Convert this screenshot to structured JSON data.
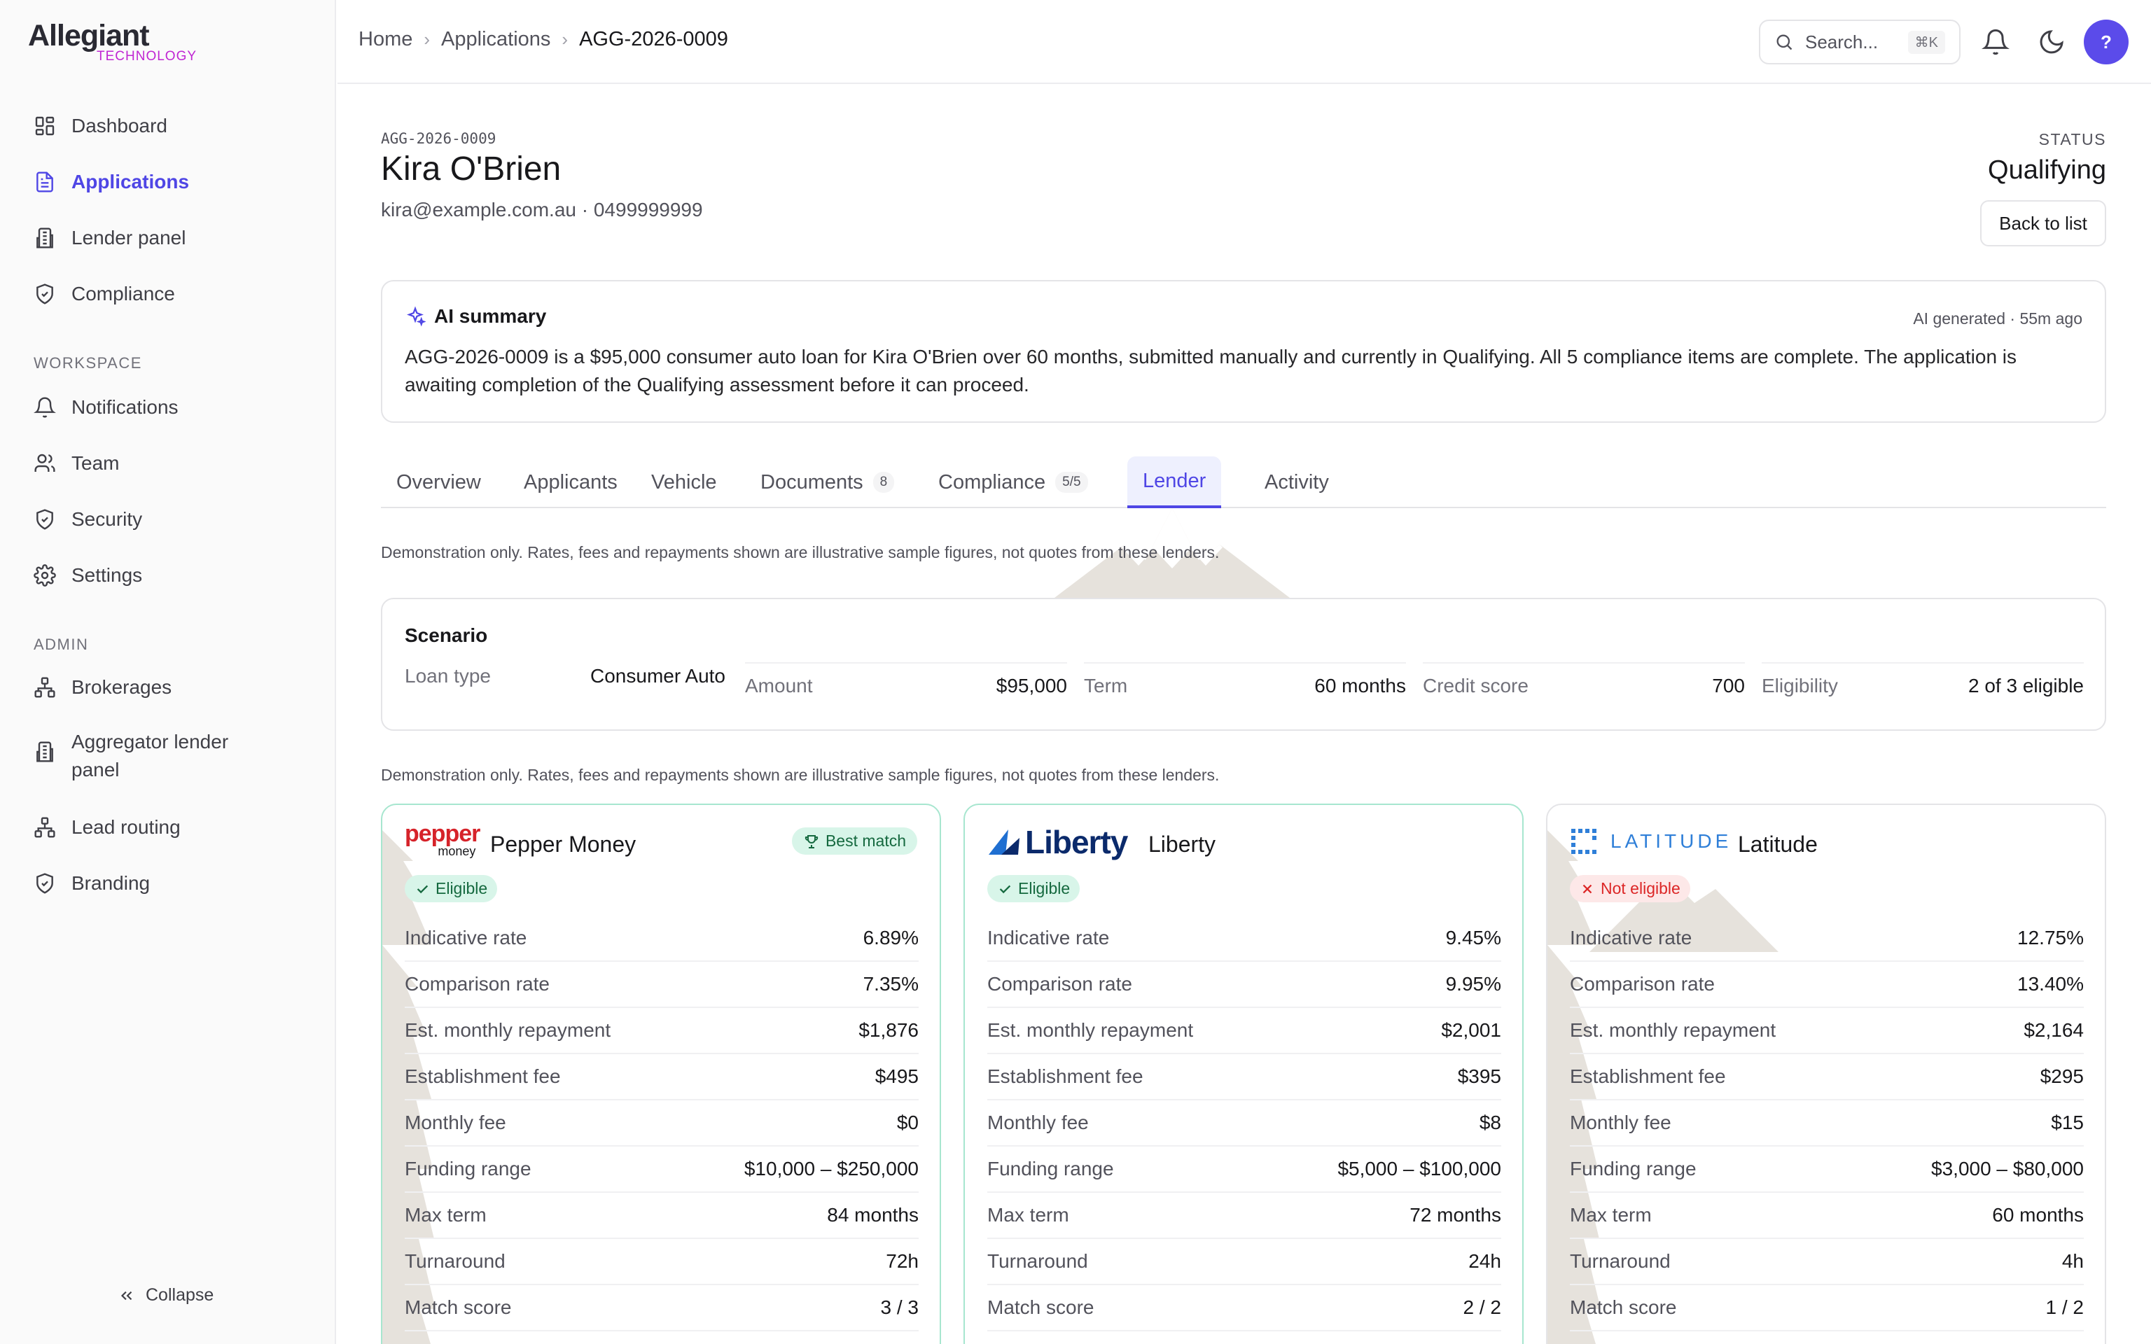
{
  "brand": {
    "name": "Allegiant",
    "sub": "TECHNOLOGY"
  },
  "sidebar": {
    "items": [
      {
        "label": "Dashboard",
        "icon": "dashboard-icon"
      },
      {
        "label": "Applications",
        "icon": "file-text-icon",
        "active": true
      },
      {
        "label": "Lender panel",
        "icon": "building-icon"
      },
      {
        "label": "Compliance",
        "icon": "shield-check-icon"
      }
    ],
    "workspace_heading": "WORKSPACE",
    "workspace": [
      {
        "label": "Notifications",
        "icon": "bell-icon"
      },
      {
        "label": "Team",
        "icon": "users-icon"
      },
      {
        "label": "Security",
        "icon": "shield-check-icon"
      },
      {
        "label": "Settings",
        "icon": "gear-icon"
      }
    ],
    "admin_heading": "ADMIN",
    "admin": [
      {
        "label": "Brokerages",
        "icon": "network-icon"
      },
      {
        "label": "Aggregator lender panel",
        "icon": "building-icon"
      },
      {
        "label": "Lead routing",
        "icon": "network-icon"
      },
      {
        "label": "Branding",
        "icon": "shield-icon"
      }
    ],
    "collapse_label": "Collapse"
  },
  "topbar": {
    "breadcrumb": [
      "Home",
      "Applications",
      "AGG-2026-0009"
    ],
    "search_placeholder": "Search...",
    "search_shortcut": "⌘K",
    "avatar_label": "?"
  },
  "application": {
    "id": "AGG-2026-0009",
    "name": "Kira O'Brien",
    "contact": "kira@example.com.au · 0499999999",
    "status_label": "STATUS",
    "status": "Qualifying",
    "back_label": "Back to list"
  },
  "ai_summary": {
    "title": "AI summary",
    "meta": "AI generated · 55m ago",
    "body": "AGG-2026-0009 is a $95,000 consumer auto loan for Kira O'Brien over 60 months, submitted manually and currently in Qualifying. All 5 compliance items are complete. The application is awaiting completion of the Qualifying assessment before it can proceed."
  },
  "tabs": [
    {
      "label": "Overview",
      "count": ""
    },
    {
      "label": "Applicants",
      "count": ""
    },
    {
      "label": "Vehicle",
      "count": ""
    },
    {
      "label": "Documents",
      "count": "8"
    },
    {
      "label": "Compliance",
      "count": "5/5"
    },
    {
      "label": "Lender",
      "count": "",
      "active": true
    },
    {
      "label": "Activity",
      "count": ""
    }
  ],
  "disclaimer": "Demonstration only. Rates, fees and repayments shown are illustrative sample figures, not quotes from these lenders.",
  "scenario": {
    "title": "Scenario",
    "fields": [
      {
        "label": "Loan type",
        "value": "Consumer Auto"
      },
      {
        "label": "Amount",
        "value": "$95,000"
      },
      {
        "label": "Term",
        "value": "60 months"
      },
      {
        "label": "Credit score",
        "value": "700"
      },
      {
        "label": "Eligibility",
        "value": "2 of 3 eligible"
      }
    ]
  },
  "lenders": [
    {
      "name": "Pepper Money",
      "logo_word": "pepper",
      "logo_sub": "money",
      "badge": "Best match",
      "eligibility": "Eligible",
      "eligible": true,
      "rows": [
        {
          "k": "Indicative rate",
          "v": "6.89%"
        },
        {
          "k": "Comparison rate",
          "v": "7.35%"
        },
        {
          "k": "Est. monthly repayment",
          "v": "$1,876"
        },
        {
          "k": "Establishment fee",
          "v": "$495"
        },
        {
          "k": "Monthly fee",
          "v": "$0"
        },
        {
          "k": "Funding range",
          "v": "$10,000 – $250,000"
        },
        {
          "k": "Max term",
          "v": "84 months"
        },
        {
          "k": "Turnaround",
          "v": "72h"
        },
        {
          "k": "Match score",
          "v": "3 / 3"
        }
      ]
    },
    {
      "name": "Liberty",
      "logo_word": "Liberty",
      "eligibility": "Eligible",
      "eligible": true,
      "rows": [
        {
          "k": "Indicative rate",
          "v": "9.45%"
        },
        {
          "k": "Comparison rate",
          "v": "9.95%"
        },
        {
          "k": "Est. monthly repayment",
          "v": "$2,001"
        },
        {
          "k": "Establishment fee",
          "v": "$395"
        },
        {
          "k": "Monthly fee",
          "v": "$8"
        },
        {
          "k": "Funding range",
          "v": "$5,000 – $100,000"
        },
        {
          "k": "Max term",
          "v": "72 months"
        },
        {
          "k": "Turnaround",
          "v": "24h"
        },
        {
          "k": "Match score",
          "v": "2 / 2"
        }
      ]
    },
    {
      "name": "Latitude",
      "logo_word": "LATITUDE",
      "eligibility": "Not eligible",
      "eligible": false,
      "rows": [
        {
          "k": "Indicative rate",
          "v": "12.75%"
        },
        {
          "k": "Comparison rate",
          "v": "13.40%"
        },
        {
          "k": "Est. monthly repayment",
          "v": "$2,164"
        },
        {
          "k": "Establishment fee",
          "v": "$295"
        },
        {
          "k": "Monthly fee",
          "v": "$15"
        },
        {
          "k": "Funding range",
          "v": "$3,000 – $80,000"
        },
        {
          "k": "Max term",
          "v": "60 months"
        },
        {
          "k": "Turnaround",
          "v": "4h"
        },
        {
          "k": "Match score",
          "v": "1 / 2"
        }
      ]
    }
  ],
  "colors": {
    "accent": "#4f46e5",
    "eligible": "#15693f",
    "not_eligible": "#dc2626",
    "brand_sub": "#c026d3"
  }
}
